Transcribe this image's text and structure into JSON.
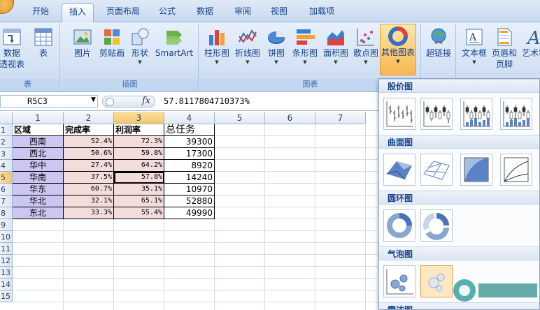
{
  "tabs": [
    {
      "label": "开始",
      "active": false
    },
    {
      "label": "插入",
      "active": true
    },
    {
      "label": "页面布局",
      "active": false
    },
    {
      "label": "公式",
      "active": false
    },
    {
      "label": "数据",
      "active": false
    },
    {
      "label": "审阅",
      "active": false
    },
    {
      "label": "视图",
      "active": false
    },
    {
      "label": "加载项",
      "active": false
    }
  ],
  "ribbon": {
    "groups": [
      {
        "label": "表",
        "buttons": [
          {
            "label": "数据",
            "label2": "透视表",
            "icon": "pivot-table-icon"
          },
          {
            "label": "表",
            "icon": "table-icon"
          }
        ]
      },
      {
        "label": "插图",
        "buttons": [
          {
            "label": "图片",
            "icon": "picture-icon"
          },
          {
            "label": "剪贴画",
            "icon": "clipart-icon"
          },
          {
            "label": "形状",
            "icon": "shapes-icon"
          },
          {
            "label": "SmartArt",
            "icon": "smartart-icon"
          }
        ]
      },
      {
        "label": "图表",
        "buttons": [
          {
            "label": "柱形图",
            "icon": "column-chart-icon"
          },
          {
            "label": "折线图",
            "icon": "line-chart-icon"
          },
          {
            "label": "饼图",
            "icon": "pie-chart-icon"
          },
          {
            "label": "条形图",
            "icon": "bar-chart-icon"
          },
          {
            "label": "面积图",
            "icon": "area-chart-icon"
          },
          {
            "label": "散点图",
            "icon": "scatter-chart-icon"
          },
          {
            "label": "其他图表",
            "icon": "other-charts-icon"
          }
        ]
      },
      {
        "label": "",
        "buttons": [
          {
            "label": "超链接",
            "icon": "hyperlink-icon"
          }
        ]
      },
      {
        "label": "",
        "buttons": [
          {
            "label": "文本框",
            "icon": "textbox-icon"
          },
          {
            "label": "页眉和",
            "label2": "页脚",
            "icon": "header-footer-icon"
          },
          {
            "label": "艺术字",
            "icon": "wordart-icon"
          }
        ]
      }
    ]
  },
  "formula_bar": {
    "name_box": "R5C3",
    "fx": "fx",
    "value": "57.8117804710373%"
  },
  "grid": {
    "columns": [
      "1",
      "2",
      "3",
      "4",
      "5",
      "6",
      "7"
    ],
    "rows": [
      "1",
      "2",
      "3",
      "4",
      "5",
      "6",
      "7",
      "8",
      "9",
      "10",
      "11",
      "12",
      "13",
      "14",
      "15"
    ],
    "header": [
      "区域",
      "完成率",
      "利润率",
      "总任务"
    ],
    "data": [
      [
        "西南",
        "52.4%",
        "72.3%",
        "39300"
      ],
      [
        "西北",
        "50.6%",
        "59.8%",
        "17300"
      ],
      [
        "华中",
        "27.4%",
        "64.2%",
        "8920"
      ],
      [
        "华南",
        "37.5%",
        "57.8%",
        "14240"
      ],
      [
        "华东",
        "60.7%",
        "35.1%",
        "10970"
      ],
      [
        "华北",
        "32.1%",
        "65.1%",
        "52880"
      ],
      [
        "东北",
        "33.3%",
        "55.4%",
        "49990"
      ]
    ],
    "selected_row": "5",
    "selected_col": "3"
  },
  "gallery": {
    "sections": [
      {
        "title": "股价图",
        "count": 4
      },
      {
        "title": "曲面图",
        "count": 4
      },
      {
        "title": "圆环图",
        "count": 2
      },
      {
        "title": "气泡图",
        "count": 2
      },
      {
        "title": "雷达图",
        "count": 0
      }
    ]
  },
  "colors": {
    "accent": "#15428b",
    "region_fill": "#ccc6f2",
    "pct_fill": "#f3dcdc",
    "active_button": "#f8b650"
  }
}
